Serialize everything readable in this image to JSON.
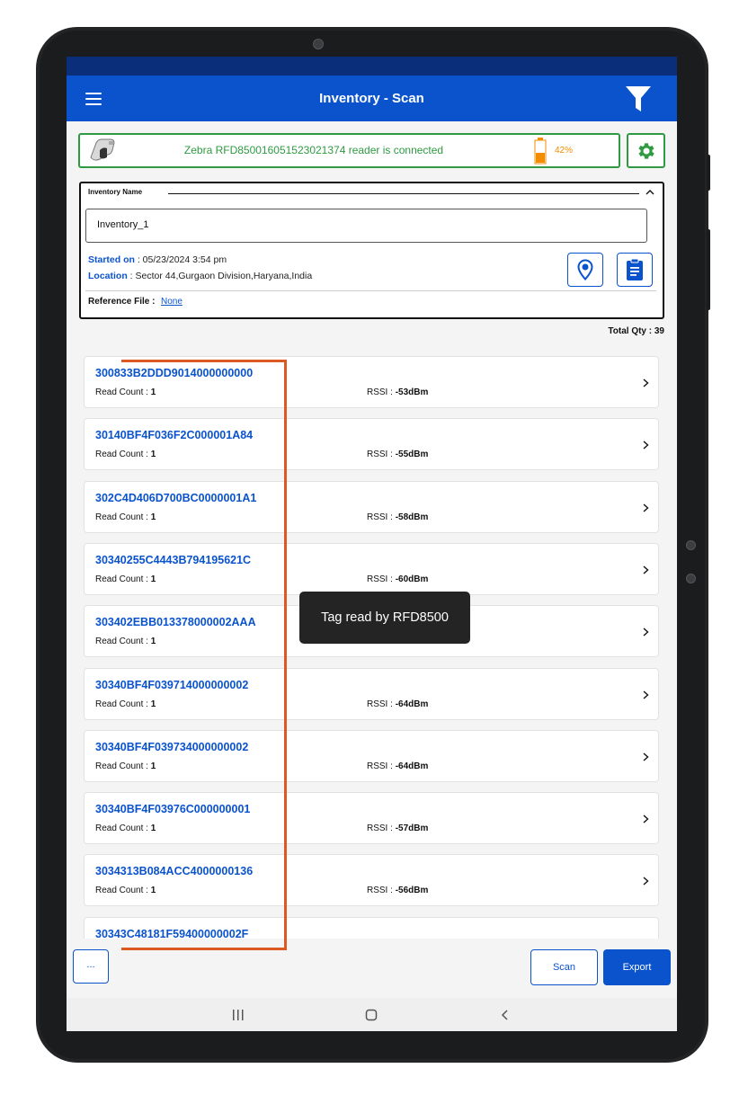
{
  "app": {
    "title": "Inventory - Scan"
  },
  "reader": {
    "status": "Zebra RFD850016051523021374 reader is connected",
    "battery_label": "42%",
    "battery_level": 0.42
  },
  "inventory": {
    "name_label": "Inventory Name",
    "name_value": "Inventory_1",
    "started_label": "Started on",
    "started_value": ": 05/23/2024 3:54 pm",
    "location_label": "Location",
    "location_value": ": Sector 44,Gurgaon Division,Haryana,India",
    "reference_label": "Reference File :",
    "reference_value": "None"
  },
  "total_qty": "Total Qty : 39",
  "labels": {
    "read_count": "Read Count : ",
    "rssi": "RSSI : "
  },
  "tags": [
    {
      "id": "300833B2DDD9014000000000",
      "read_count": "1",
      "rssi": "-53dBm"
    },
    {
      "id": "30140BF4F036F2C000001A84",
      "read_count": "1",
      "rssi": "-55dBm"
    },
    {
      "id": "302C4D406D700BC0000001A1",
      "read_count": "1",
      "rssi": "-58dBm"
    },
    {
      "id": "30340255C4443B794195621C",
      "read_count": "1",
      "rssi": "-60dBm"
    },
    {
      "id": "303402EBB013378000002AAA",
      "read_count": "1",
      "rssi": ""
    },
    {
      "id": "30340BF4F039714000000002",
      "read_count": "1",
      "rssi": "-64dBm"
    },
    {
      "id": "30340BF4F039734000000002",
      "read_count": "1",
      "rssi": "-64dBm"
    },
    {
      "id": "30340BF4F03976C000000001",
      "read_count": "1",
      "rssi": "-57dBm"
    },
    {
      "id": "3034313B084ACC4000000136",
      "read_count": "1",
      "rssi": "-56dBm"
    },
    {
      "id": "30343C48181F59400000002F",
      "read_count": "",
      "rssi": ""
    }
  ],
  "tooltip": "Tag read by RFD8500",
  "buttons": {
    "more": "...",
    "scan": "Scan",
    "export": "Export"
  },
  "colors": {
    "primary": "#0a53cd",
    "connected": "#2f9a42",
    "battery": "#f28c00",
    "annotation": "#dc5a22"
  }
}
